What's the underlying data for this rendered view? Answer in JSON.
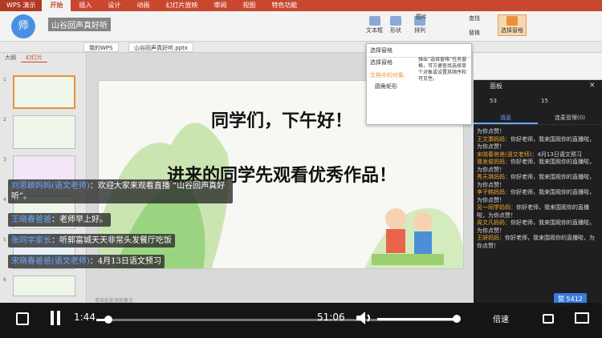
{
  "app": {
    "name": "WPS 演示",
    "tabs": [
      "开始",
      "插入",
      "设计",
      "动画",
      "幻灯片放映",
      "审阅",
      "视图",
      "特色功能"
    ]
  },
  "stream_title": "山谷回声真好听",
  "ribbon": {
    "buttons": [
      "文本框",
      "形状",
      "排列",
      "替换",
      "选择窗格"
    ],
    "items": [
      "图片",
      "查找",
      "编号",
      "颜色"
    ]
  },
  "doc_tabs": [
    "我的WPS",
    "山谷回声真好听.pptx"
  ],
  "left_panel": {
    "tabs": [
      "大纲",
      "幻灯片"
    ],
    "slide_numbers": [
      "1",
      "2",
      "3",
      "4",
      "5",
      "6"
    ]
  },
  "slide": {
    "greeting": "同学们，下午好！",
    "invite": "进来的同学先观看优秀作品！"
  },
  "selection_pane": {
    "title": "选择窗格",
    "label": "选择窗格",
    "section": "文档中的对象:",
    "item": "圆角矩形",
    "desc": "弹出“选择窗格”任务窗格，可方便查找选择单个对象或设置其顺序和可见性。"
  },
  "live": {
    "header": "面板",
    "counts": [
      "53",
      "15"
    ],
    "tabs": [
      "消息",
      "连麦管理(0)"
    ],
    "messages": [
      {
        "name": "",
        "text": "为你点赞！"
      },
      {
        "name": "王文灏妈妈：",
        "text": "你好老师，我来围观你的直播啦，为你点赞！"
      },
      {
        "name": "宋晓春爸爸(语文老师)：",
        "text": "4月13日语文预习"
      },
      {
        "name": "督发俊妈妈：",
        "text": "你好老师，我来围观你的直播啦，为你点赞！"
      },
      {
        "name": "秀天琪妈妈：",
        "text": "你好老师，我来围观你的直播啦，为你点赞！"
      },
      {
        "name": "李子韩妈妈：",
        "text": "你好老师，我来围观你的直播啦，为你点赞！"
      },
      {
        "name": "另一同学妈妈：",
        "text": "你好老师，我来围观你的直播啦，为你点赞！"
      },
      {
        "name": "周文凡妈妈：",
        "text": "你好老师，我来围观你的直播啦，为你点赞！"
      },
      {
        "name": "王妍妈妈：",
        "text": "你好老师，我来围观你的直播啦，为你点赞！"
      }
    ],
    "likes_label": "赞 5412"
  },
  "chat_overlay": [
    {
      "name": "刘思颖妈妈(语文老师)",
      "text": "：欢迎大家来观看直播 “山谷回声真好听”。"
    },
    {
      "name": "王晓春爸爸",
      "text": "：老师早上好。"
    },
    {
      "name": "张同学家长",
      "text": "：听郭富城天天非常头发餐厅吃饭"
    },
    {
      "name": "宋晓春爸爸(语文老师)",
      "text": "：4月13日语文预习"
    }
  ],
  "player": {
    "elapsed": "1:44",
    "total": "51:06",
    "speed": "倍速",
    "progress": 0.034
  },
  "status": {
    "note": "单击此处添加备注"
  },
  "colors": {
    "brand": "#c9472f",
    "accent": "#f5a623",
    "link": "#6aa8ff"
  }
}
